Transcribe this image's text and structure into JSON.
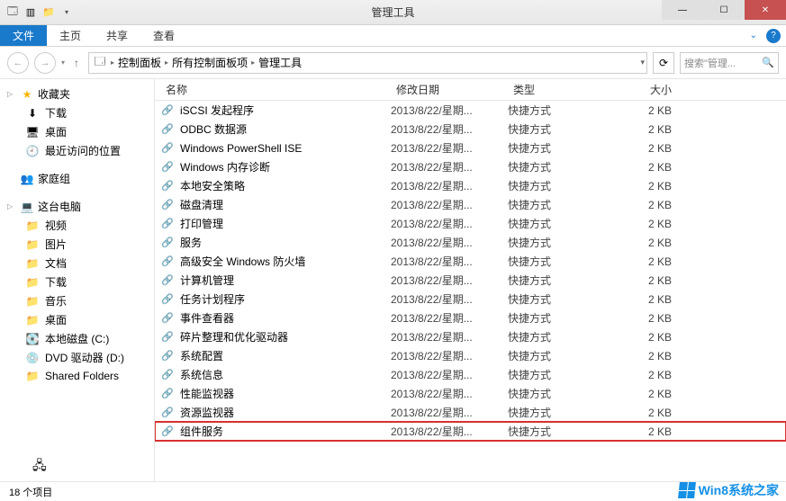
{
  "window": {
    "title": "管理工具"
  },
  "ribbon": {
    "file": "文件",
    "tabs": [
      "主页",
      "共享",
      "查看"
    ]
  },
  "nav": {
    "crumbs": [
      "控制面板",
      "所有控制面板项",
      "管理工具"
    ],
    "search_placeholder": "搜索\"管理..."
  },
  "sidebar": {
    "favorites": {
      "label": "收藏夹",
      "items": [
        "下载",
        "桌面",
        "最近访问的位置"
      ]
    },
    "homegroup": {
      "label": "家庭组"
    },
    "thispc": {
      "label": "这台电脑",
      "items": [
        "视频",
        "图片",
        "文档",
        "下载",
        "音乐",
        "桌面",
        "本地磁盘 (C:)",
        "DVD 驱动器 (D:)",
        "Shared Folders"
      ]
    },
    "network": {
      "label": "网络"
    }
  },
  "columns": {
    "name": "名称",
    "date": "修改日期",
    "type": "类型",
    "size": "大小"
  },
  "files": [
    {
      "name": "iSCSI 发起程序",
      "date": "2013/8/22/星期...",
      "type": "快捷方式",
      "size": "2 KB"
    },
    {
      "name": "ODBC 数据源",
      "date": "2013/8/22/星期...",
      "type": "快捷方式",
      "size": "2 KB"
    },
    {
      "name": "Windows PowerShell ISE",
      "date": "2013/8/22/星期...",
      "type": "快捷方式",
      "size": "2 KB"
    },
    {
      "name": "Windows 内存诊断",
      "date": "2013/8/22/星期...",
      "type": "快捷方式",
      "size": "2 KB"
    },
    {
      "name": "本地安全策略",
      "date": "2013/8/22/星期...",
      "type": "快捷方式",
      "size": "2 KB"
    },
    {
      "name": "磁盘清理",
      "date": "2013/8/22/星期...",
      "type": "快捷方式",
      "size": "2 KB"
    },
    {
      "name": "打印管理",
      "date": "2013/8/22/星期...",
      "type": "快捷方式",
      "size": "2 KB"
    },
    {
      "name": "服务",
      "date": "2013/8/22/星期...",
      "type": "快捷方式",
      "size": "2 KB"
    },
    {
      "name": "高级安全 Windows 防火墙",
      "date": "2013/8/22/星期...",
      "type": "快捷方式",
      "size": "2 KB"
    },
    {
      "name": "计算机管理",
      "date": "2013/8/22/星期...",
      "type": "快捷方式",
      "size": "2 KB"
    },
    {
      "name": "任务计划程序",
      "date": "2013/8/22/星期...",
      "type": "快捷方式",
      "size": "2 KB"
    },
    {
      "name": "事件查看器",
      "date": "2013/8/22/星期...",
      "type": "快捷方式",
      "size": "2 KB"
    },
    {
      "name": "碎片整理和优化驱动器",
      "date": "2013/8/22/星期...",
      "type": "快捷方式",
      "size": "2 KB"
    },
    {
      "name": "系统配置",
      "date": "2013/8/22/星期...",
      "type": "快捷方式",
      "size": "2 KB"
    },
    {
      "name": "系统信息",
      "date": "2013/8/22/星期...",
      "type": "快捷方式",
      "size": "2 KB"
    },
    {
      "name": "性能监视器",
      "date": "2013/8/22/星期...",
      "type": "快捷方式",
      "size": "2 KB"
    },
    {
      "name": "资源监视器",
      "date": "2013/8/22/星期...",
      "type": "快捷方式",
      "size": "2 KB"
    },
    {
      "name": "组件服务",
      "date": "2013/8/22/星期...",
      "type": "快捷方式",
      "size": "2 KB",
      "hl": true
    }
  ],
  "status": {
    "count": "18 个项目"
  },
  "watermark": "Win8系统之家"
}
